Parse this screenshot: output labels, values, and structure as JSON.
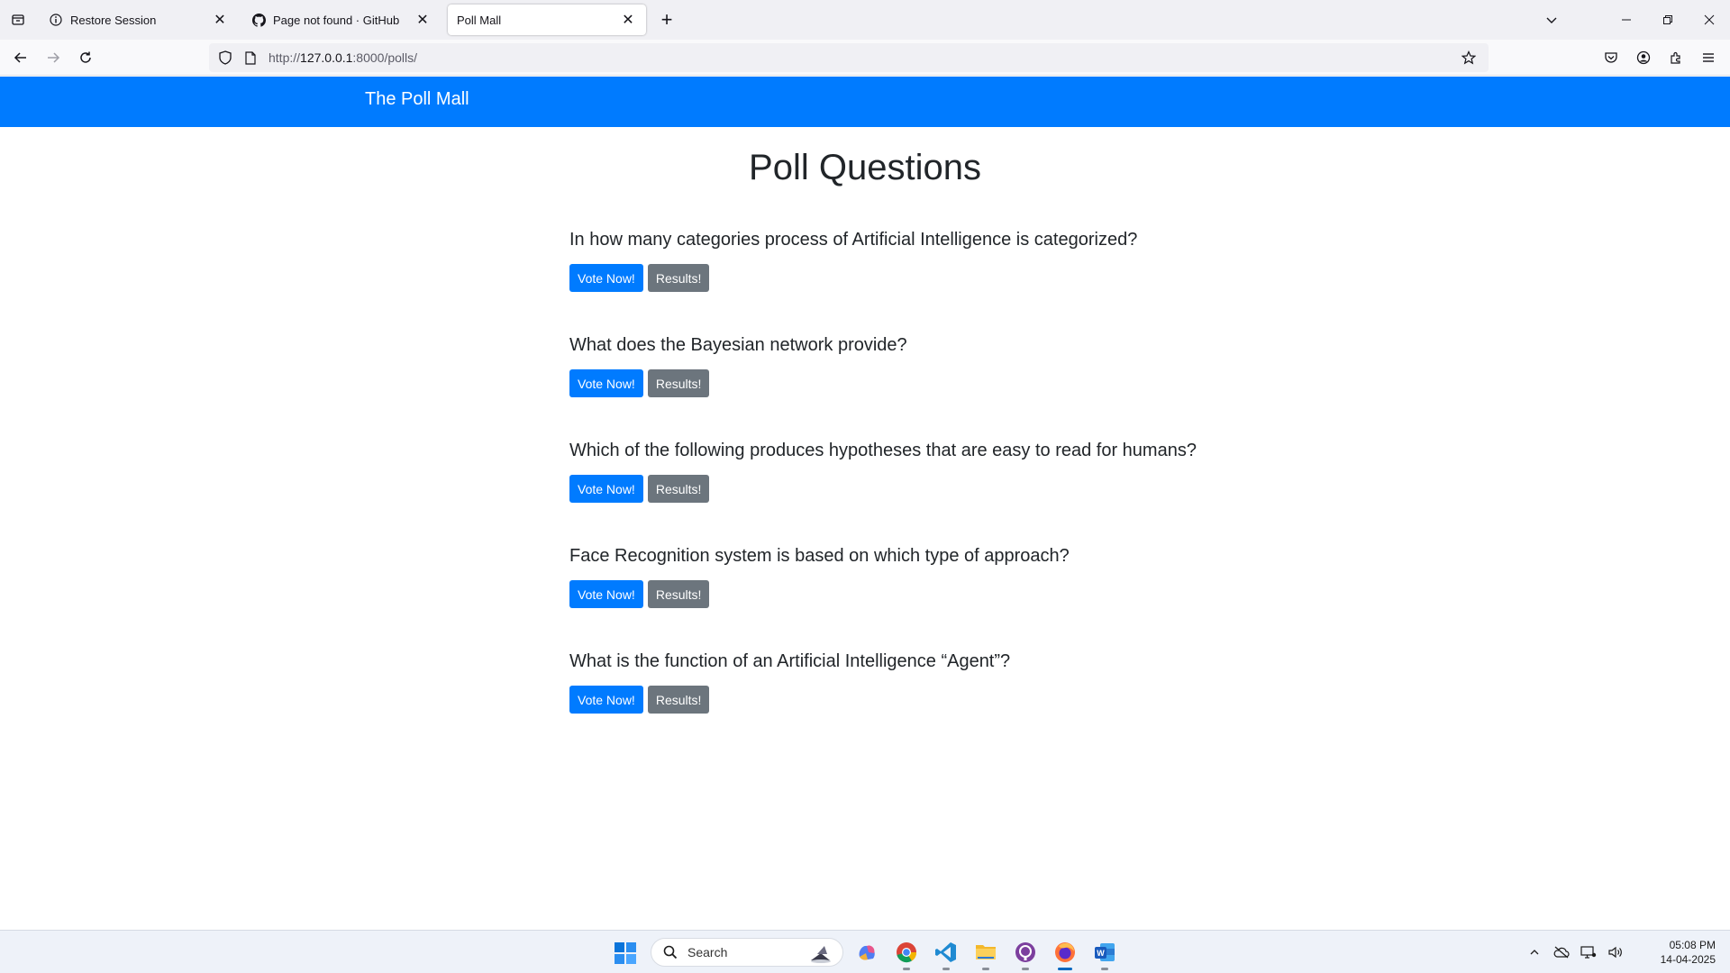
{
  "browser": {
    "tabs": [
      {
        "label": "Restore Session",
        "icon": "info-icon",
        "active": false
      },
      {
        "label": "Page not found · GitHub",
        "icon": "github-icon",
        "active": false
      },
      {
        "label": "Poll Mall",
        "icon": "",
        "active": true
      }
    ],
    "url_prefix": "http://",
    "url_host": "127.0.0.1",
    "url_rest": ":8000/polls/"
  },
  "site": {
    "brand": "The Poll Mall",
    "page_title": "Poll Questions",
    "vote_label": "Vote Now!",
    "results_label": "Results!",
    "polls": [
      {
        "question": "In how many categories process of Artificial Intelligence is categorized?"
      },
      {
        "question": "What does the Bayesian network provide?"
      },
      {
        "question": "Which of the following produces hypotheses that are easy to read for humans?"
      },
      {
        "question": "Face Recognition system is based on which type of approach?"
      },
      {
        "question": "What is the function of an Artificial Intelligence “Agent”?"
      }
    ],
    "colors": {
      "primary": "#007bff",
      "secondary": "#6c757d"
    }
  },
  "taskbar": {
    "search_placeholder": "Search",
    "time": "05:08 PM",
    "date": "14-04-2025"
  }
}
